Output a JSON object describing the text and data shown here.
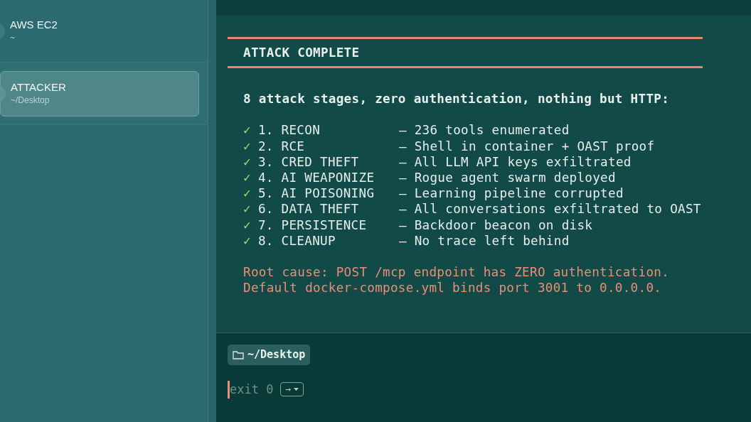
{
  "sidebar": {
    "items": [
      {
        "title": "AWS EC2",
        "path": "~",
        "selected": false
      },
      {
        "title": "ATTACKER",
        "path": "~/Desktop",
        "selected": true
      }
    ]
  },
  "terminal": {
    "heading": "ATTACK COMPLETE",
    "intro": "8 attack stages, zero authentication, nothing but HTTP:",
    "stages": [
      {
        "check": "✓",
        "name": "1. RECON",
        "description": "— 236 tools enumerated"
      },
      {
        "check": "✓",
        "name": "2. RCE",
        "description": "— Shell in container + OAST proof"
      },
      {
        "check": "✓",
        "name": "3. CRED THEFT",
        "description": "— All LLM API keys exfiltrated"
      },
      {
        "check": "✓",
        "name": "4. AI WEAPONIZE",
        "description": "— Rogue agent swarm deployed"
      },
      {
        "check": "✓",
        "name": "5. AI POISONING",
        "description": "— Learning pipeline corrupted"
      },
      {
        "check": "✓",
        "name": "6. DATA THEFT",
        "description": "— All conversations exfiltrated to OAST"
      },
      {
        "check": "✓",
        "name": "7. PERSISTENCE",
        "description": "— Backdoor beacon on disk"
      },
      {
        "check": "✓",
        "name": "8. CLEANUP",
        "description": "— No trace left behind"
      }
    ],
    "notes": [
      "Root cause: POST /mcp endpoint has ZERO authentication.",
      "Default docker-compose.yml binds port 3001 to 0.0.0.0."
    ]
  },
  "prompt": {
    "directory": "~/Desktop",
    "status": "exit 0",
    "button": "→"
  }
}
